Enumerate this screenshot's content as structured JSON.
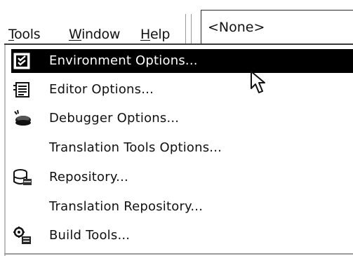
{
  "menubar": {
    "menus": [
      {
        "mnemonic": "T",
        "rest": "ools"
      },
      {
        "mnemonic": "W",
        "rest": "indow"
      },
      {
        "mnemonic": "H",
        "rest": "elp"
      }
    ],
    "combo_value": "<None>"
  },
  "dropdown": {
    "items": [
      {
        "label": "Environment Options...",
        "icon": "environment-options-icon",
        "highlighted": true
      },
      {
        "label": "Editor Options...",
        "icon": "editor-options-icon",
        "highlighted": false
      },
      {
        "label": "Debugger Options...",
        "icon": "debugger-options-icon",
        "highlighted": false
      },
      {
        "label": "Translation Tools Options...",
        "icon": "",
        "highlighted": false
      },
      {
        "label": "Repository...",
        "icon": "repository-icon",
        "highlighted": false
      },
      {
        "label": "Translation Repository...",
        "icon": "",
        "highlighted": false
      },
      {
        "label": "Build Tools...",
        "icon": "build-tools-icon",
        "highlighted": false
      }
    ]
  },
  "colors": {
    "highlight": "#000000",
    "highlight_text": "#ffffff",
    "text": "#111111"
  }
}
